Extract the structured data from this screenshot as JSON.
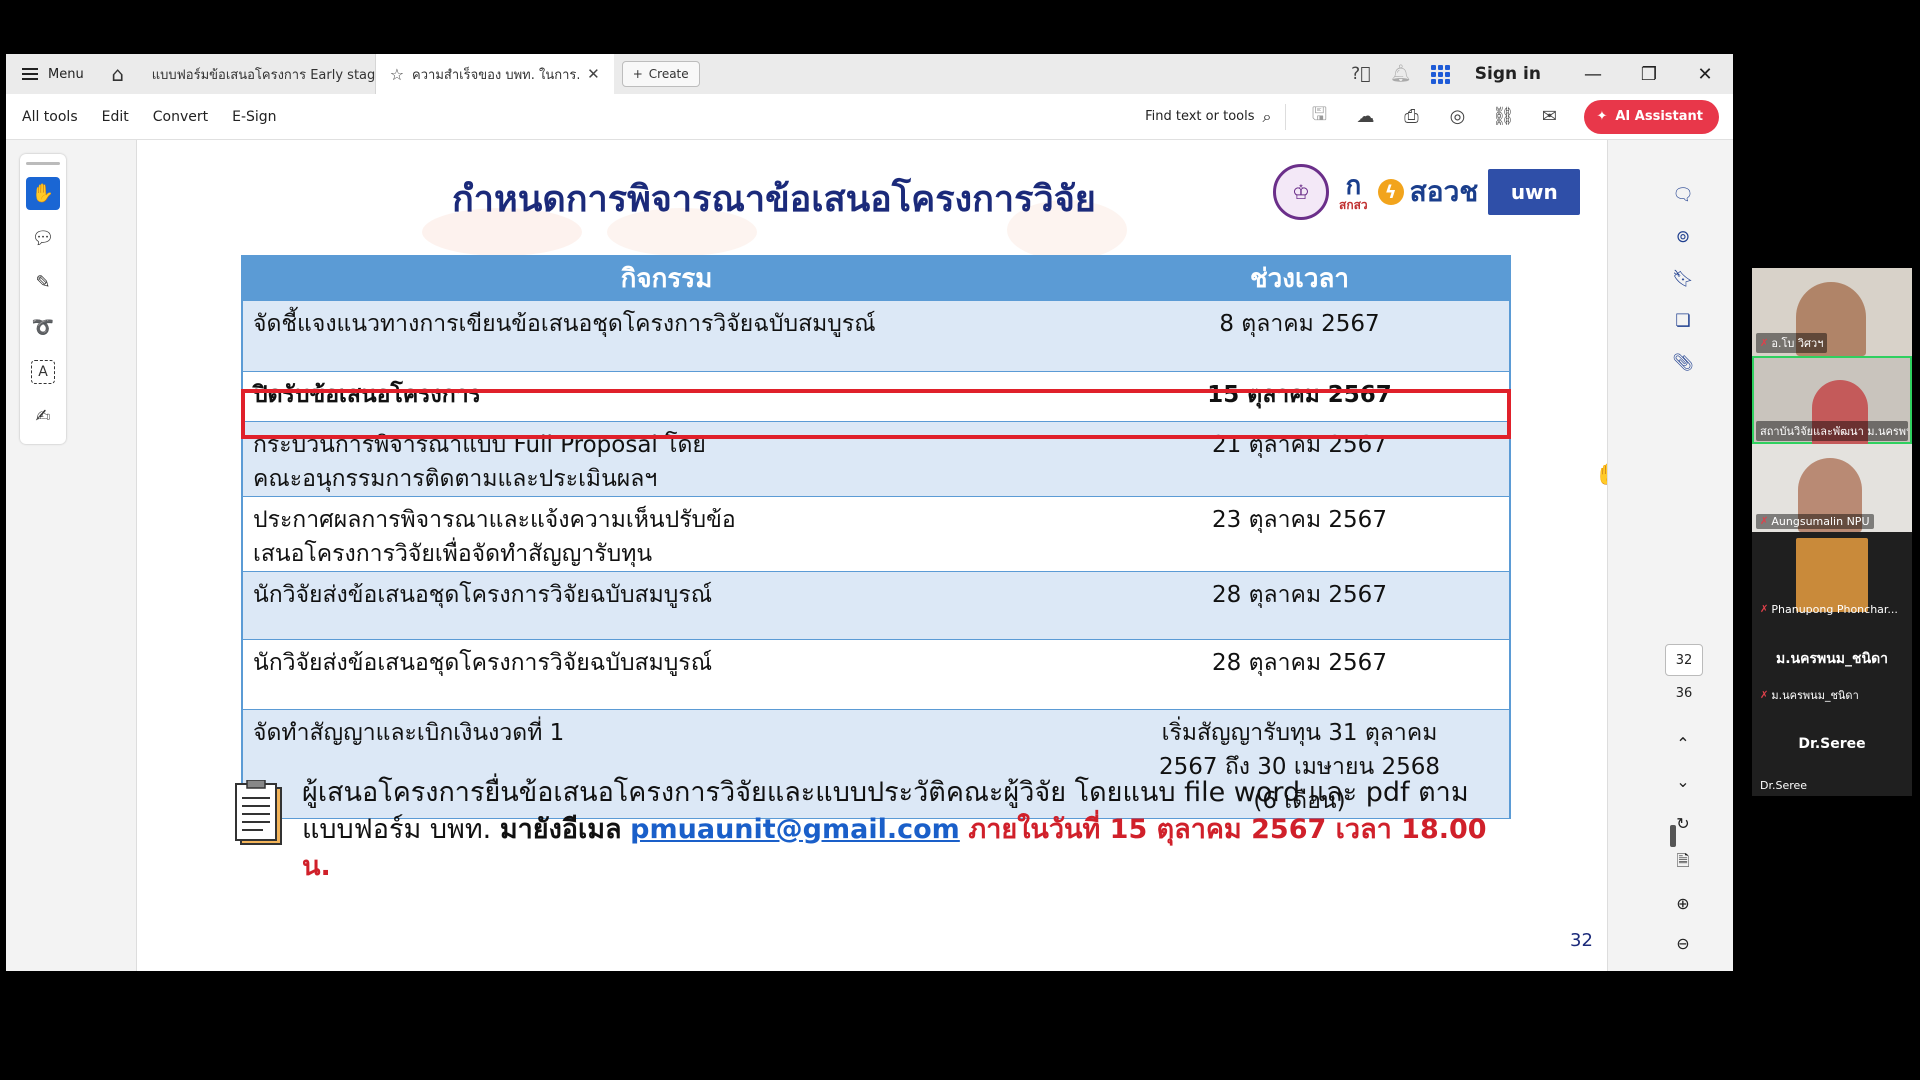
{
  "tabbar": {
    "menu_label": "Menu",
    "tab1_label": "แบบฟอร์มข้อเสนอโครงการ Early stag...",
    "tab2_label": "ความสำเร็จของ บพท. ในการ...",
    "create_label": "Create",
    "signin_label": "Sign in"
  },
  "toolbar": {
    "menus": [
      "All tools",
      "Edit",
      "Convert",
      "E-Sign"
    ],
    "find_label": "Find text or tools",
    "ai_label": "AI Assistant"
  },
  "document": {
    "title": "กำหนดการพิจารณาข้อเสนอโครงการวิจัย",
    "logos": {
      "hs": "ก",
      "hs_sub": "สกสว",
      "sorw": "สอวช",
      "uwn": "uwn"
    },
    "table": {
      "headers": [
        "กิจกรรม",
        "ช่วงเวลา"
      ],
      "rows": [
        {
          "activity": "จัดชี้แจงแนวทางการเขียนข้อเสนอชุดโครงการวิจัยฉบับสมบูรณ์",
          "date": "8 ตุลาคม 2567"
        },
        {
          "activity": "ปิดรับข้อเสนอโครงการ",
          "date": "15 ตุลาคม 2567"
        },
        {
          "activity": "กระบวนการพิจารณาแบบ Full Proposal โดยคณะอนุกรรมการติดตามและประเมินผลฯ",
          "date": "21 ตุลาคม 2567"
        },
        {
          "activity": "ประกาศผลการพิจารณาและแจ้งความเห็นปรับข้อเสนอโครงการวิจัยเพื่อจัดทำสัญญารับทุน",
          "date": "23 ตุลาคม 2567"
        },
        {
          "activity": "นักวิจัยส่งข้อเสนอชุดโครงการวิจัยฉบับสมบูรณ์",
          "date": "28 ตุลาคม 2567"
        },
        {
          "activity": "นักวิจัยส่งข้อเสนอชุดโครงการวิจัยฉบับสมบูรณ์",
          "date": "28 ตุลาคม 2567"
        },
        {
          "activity": "จัดทำสัญญาและเบิกเงินงวดที่ 1",
          "date": "เริ่มสัญญารับทุน 31 ตุลาคม 2567 ถึง 30 เมษายน 2568 (6 เดือน)"
        }
      ]
    },
    "note": {
      "part1": "ผู้เสนอโครงการยื่นข้อเสนอโครงการวิจัยและแบบประวัติคณะผู้วิจัย โดยแนบ file word และ pdf ตามแบบฟอร์ม บพท.",
      "part2": "มายังอีเมล",
      "email": "pmuaunit@gmail.com",
      "part3": "ภายในวันที่ 15 ตุลาคม 2567 เวลา 18.00 น."
    },
    "page_number": "32"
  },
  "navigation": {
    "current_page": "32",
    "total_pages": "36"
  },
  "participants": [
    {
      "name": "อ.โบ วิศวฯ",
      "type": "video"
    },
    {
      "name": "สถาบันวิจัยและพัฒนา ม.นครพนม",
      "type": "video"
    },
    {
      "name": "Aungsumalin NPU",
      "type": "video"
    },
    {
      "name": "Phanupong Phonchar...",
      "type": "video"
    },
    {
      "name": "ม.นครพนม_ชนิดา",
      "big": "ม.นครพนม_ชนิดา",
      "type": "plain"
    },
    {
      "name": "Dr.Seree",
      "big": "Dr.Seree",
      "type": "plain"
    }
  ],
  "colors": {
    "accent_blue": "#1a66d4",
    "ai_red": "#e8374a",
    "table_header": "#5b9bd5",
    "table_alt": "#dce8f6",
    "highlight_red": "#e0202a",
    "title_navy": "#1b2a7a"
  },
  "icons": {
    "rail": [
      "hand-icon",
      "comment-icon",
      "pen-icon",
      "lasso-icon",
      "text-select-icon",
      "sign-icon"
    ],
    "right_rail": [
      "comment-panel-icon",
      "search-panel-icon",
      "bookmark-icon",
      "pages-icon",
      "attachment-icon"
    ]
  }
}
